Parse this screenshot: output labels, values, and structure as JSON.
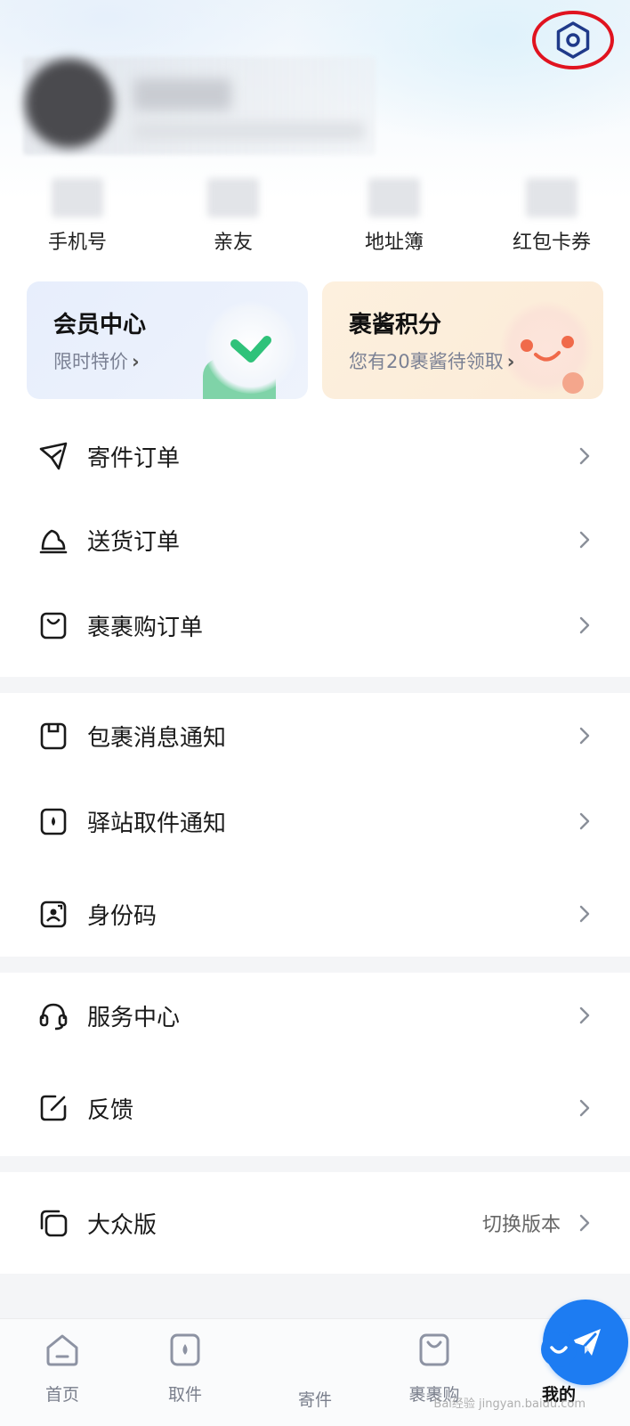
{
  "stats": [
    {
      "label": "手机号"
    },
    {
      "label": "亲友"
    },
    {
      "label": "地址簿"
    },
    {
      "label": "红包卡券"
    }
  ],
  "cards": {
    "member": {
      "title": "会员中心",
      "subtitle": "限时特价"
    },
    "points": {
      "title": "裹酱积分",
      "subtitle": "您有20裹酱待领取"
    }
  },
  "menu_groups": [
    [
      {
        "icon": "paper-plane-icon",
        "label": "寄件订单"
      },
      {
        "icon": "delivery-bag-icon",
        "label": "送货订单"
      },
      {
        "icon": "shopping-bag-icon",
        "label": "裹裹购订单"
      }
    ],
    [
      {
        "icon": "package-notice-icon",
        "label": "包裹消息通知"
      },
      {
        "icon": "station-notice-icon",
        "label": "驿站取件通知"
      },
      {
        "icon": "id-code-icon",
        "label": "身份码"
      }
    ],
    [
      {
        "icon": "headset-icon",
        "label": "服务中心"
      },
      {
        "icon": "edit-icon",
        "label": "反馈"
      }
    ],
    [
      {
        "icon": "copy-icon",
        "label": "大众版",
        "extra": "切换版本"
      }
    ]
  ],
  "tabbar": [
    {
      "icon": "home-icon",
      "label": "首页"
    },
    {
      "icon": "pickup-icon",
      "label": "取件"
    },
    {
      "icon": "send-icon",
      "label": "寄件"
    },
    {
      "icon": "bag-icon",
      "label": "裹裹购"
    },
    {
      "icon": "profile-icon",
      "label": "我的",
      "active": true
    }
  ],
  "watermark": "Bai经验 jingyan.baidu.com",
  "colors": {
    "accent": "#1d7cf2",
    "highlight_ring": "#e0131f",
    "settings_icon": "#1f3a8a"
  }
}
